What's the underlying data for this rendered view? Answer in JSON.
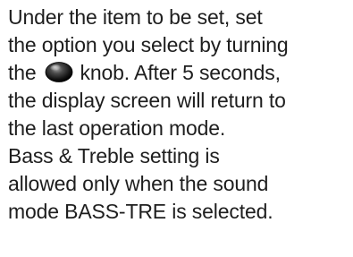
{
  "paragraph1": {
    "line1": "Under the item to be set, set",
    "line2": "the option you select by turning",
    "line3_before": "the",
    "knob_icon": "knob-icon",
    "line3_after": "knob. After 5 seconds,",
    "line4": "the display screen will return to",
    "line5": "the last operation mode."
  },
  "paragraph2": {
    "line1": "Bass & Treble setting is",
    "line2": "allowed only when the sound",
    "line3": "mode BASS-TRE is selected."
  }
}
